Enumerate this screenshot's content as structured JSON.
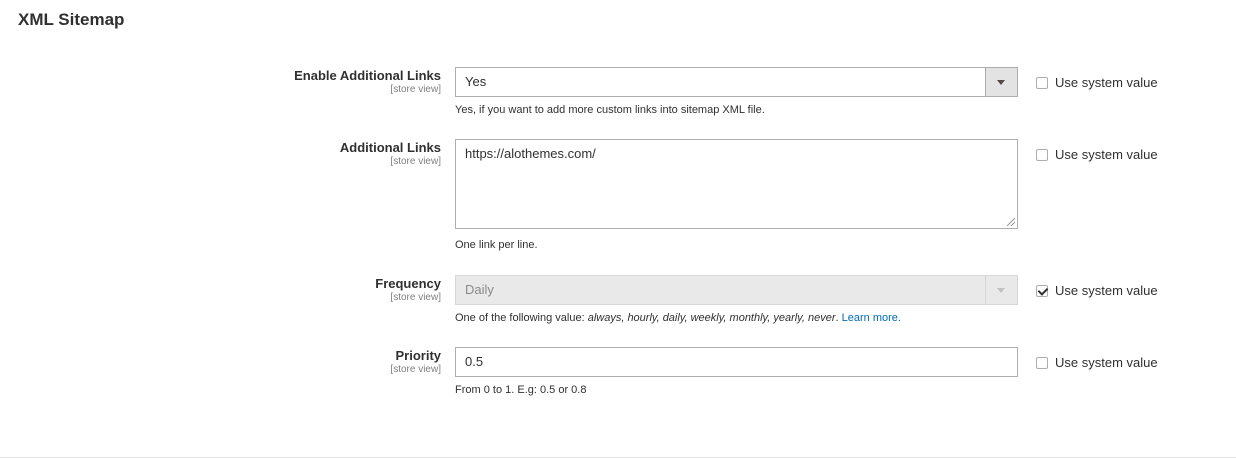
{
  "section": {
    "title": "XML Sitemap"
  },
  "fields": {
    "enable_links": {
      "label": "Enable Additional Links",
      "scope": "[store view]",
      "value": "Yes",
      "note": "Yes, if you want to add more custom links into sitemap XML file.",
      "use_system_label": "Use system value",
      "use_system_checked": false
    },
    "additional_links": {
      "label": "Additional Links",
      "scope": "[store view]",
      "value": "https://alothemes.com/",
      "note": "One link per line.",
      "use_system_label": "Use system value",
      "use_system_checked": false
    },
    "frequency": {
      "label": "Frequency",
      "scope": "[store view]",
      "value": "Daily",
      "note_prefix": "One of the following value: ",
      "note_values": "always, hourly, daily, weekly, monthly, yearly, never",
      "note_suffix": ". ",
      "learn_more": "Learn more.",
      "use_system_label": "Use system value",
      "use_system_checked": true
    },
    "priority": {
      "label": "Priority",
      "scope": "[store view]",
      "value": "0.5",
      "note": "From 0 to 1. E.g: 0.5 or 0.8",
      "use_system_label": "Use system value",
      "use_system_checked": false
    }
  }
}
